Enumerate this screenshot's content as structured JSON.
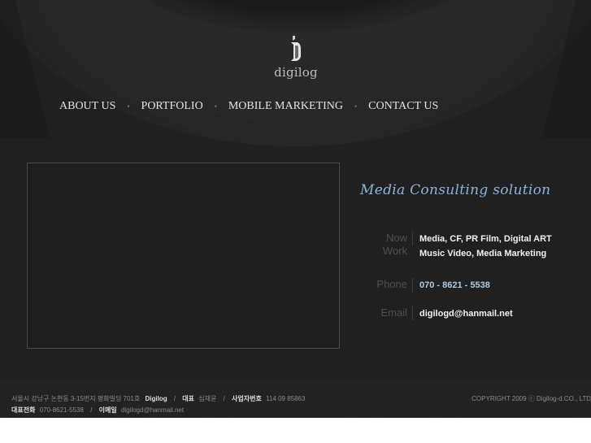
{
  "brand": {
    "logo_text": "digilog"
  },
  "nav": {
    "items": [
      {
        "label": "ABOUT US"
      },
      {
        "label": "PORTFOLIO"
      },
      {
        "label": "MOBILE MARKETING"
      },
      {
        "label": "CONTACT US"
      }
    ],
    "separator": "•"
  },
  "main": {
    "tagline": "Media Consulting solution",
    "now_work_label": "Now Work",
    "now_work_line1": "Media,  CF,  PR Film,  Digital ART",
    "now_work_line2": "Music Video,  Media Marketing",
    "phone_label": "Phone",
    "phone_value": "070 - 8621 - 5538",
    "email_label": "Email",
    "email_value": "digilogd@hanmail.net"
  },
  "footer": {
    "address": "서울시 강남구 논현동 3-15번지 평화빌딩 701호",
    "company": "Digilog",
    "separator": "/",
    "ceo_label": "대표",
    "ceo_name": "심재윤",
    "biz_no_label": "사업자번호",
    "biz_no": "114 09 85863",
    "phone_label": "대표전화",
    "phone": "070-8621-5538",
    "email_label": "이메일",
    "email": "digilogd@hanmail.net",
    "copyright": "COPYRIGHT 2009 ⓒ Digilog-d.CO., LTD"
  },
  "colors": {
    "background": "#202020",
    "tagline": "#8fb3d6",
    "accent_blue": "#a9cde8",
    "label_gray": "#4f4f4f"
  }
}
